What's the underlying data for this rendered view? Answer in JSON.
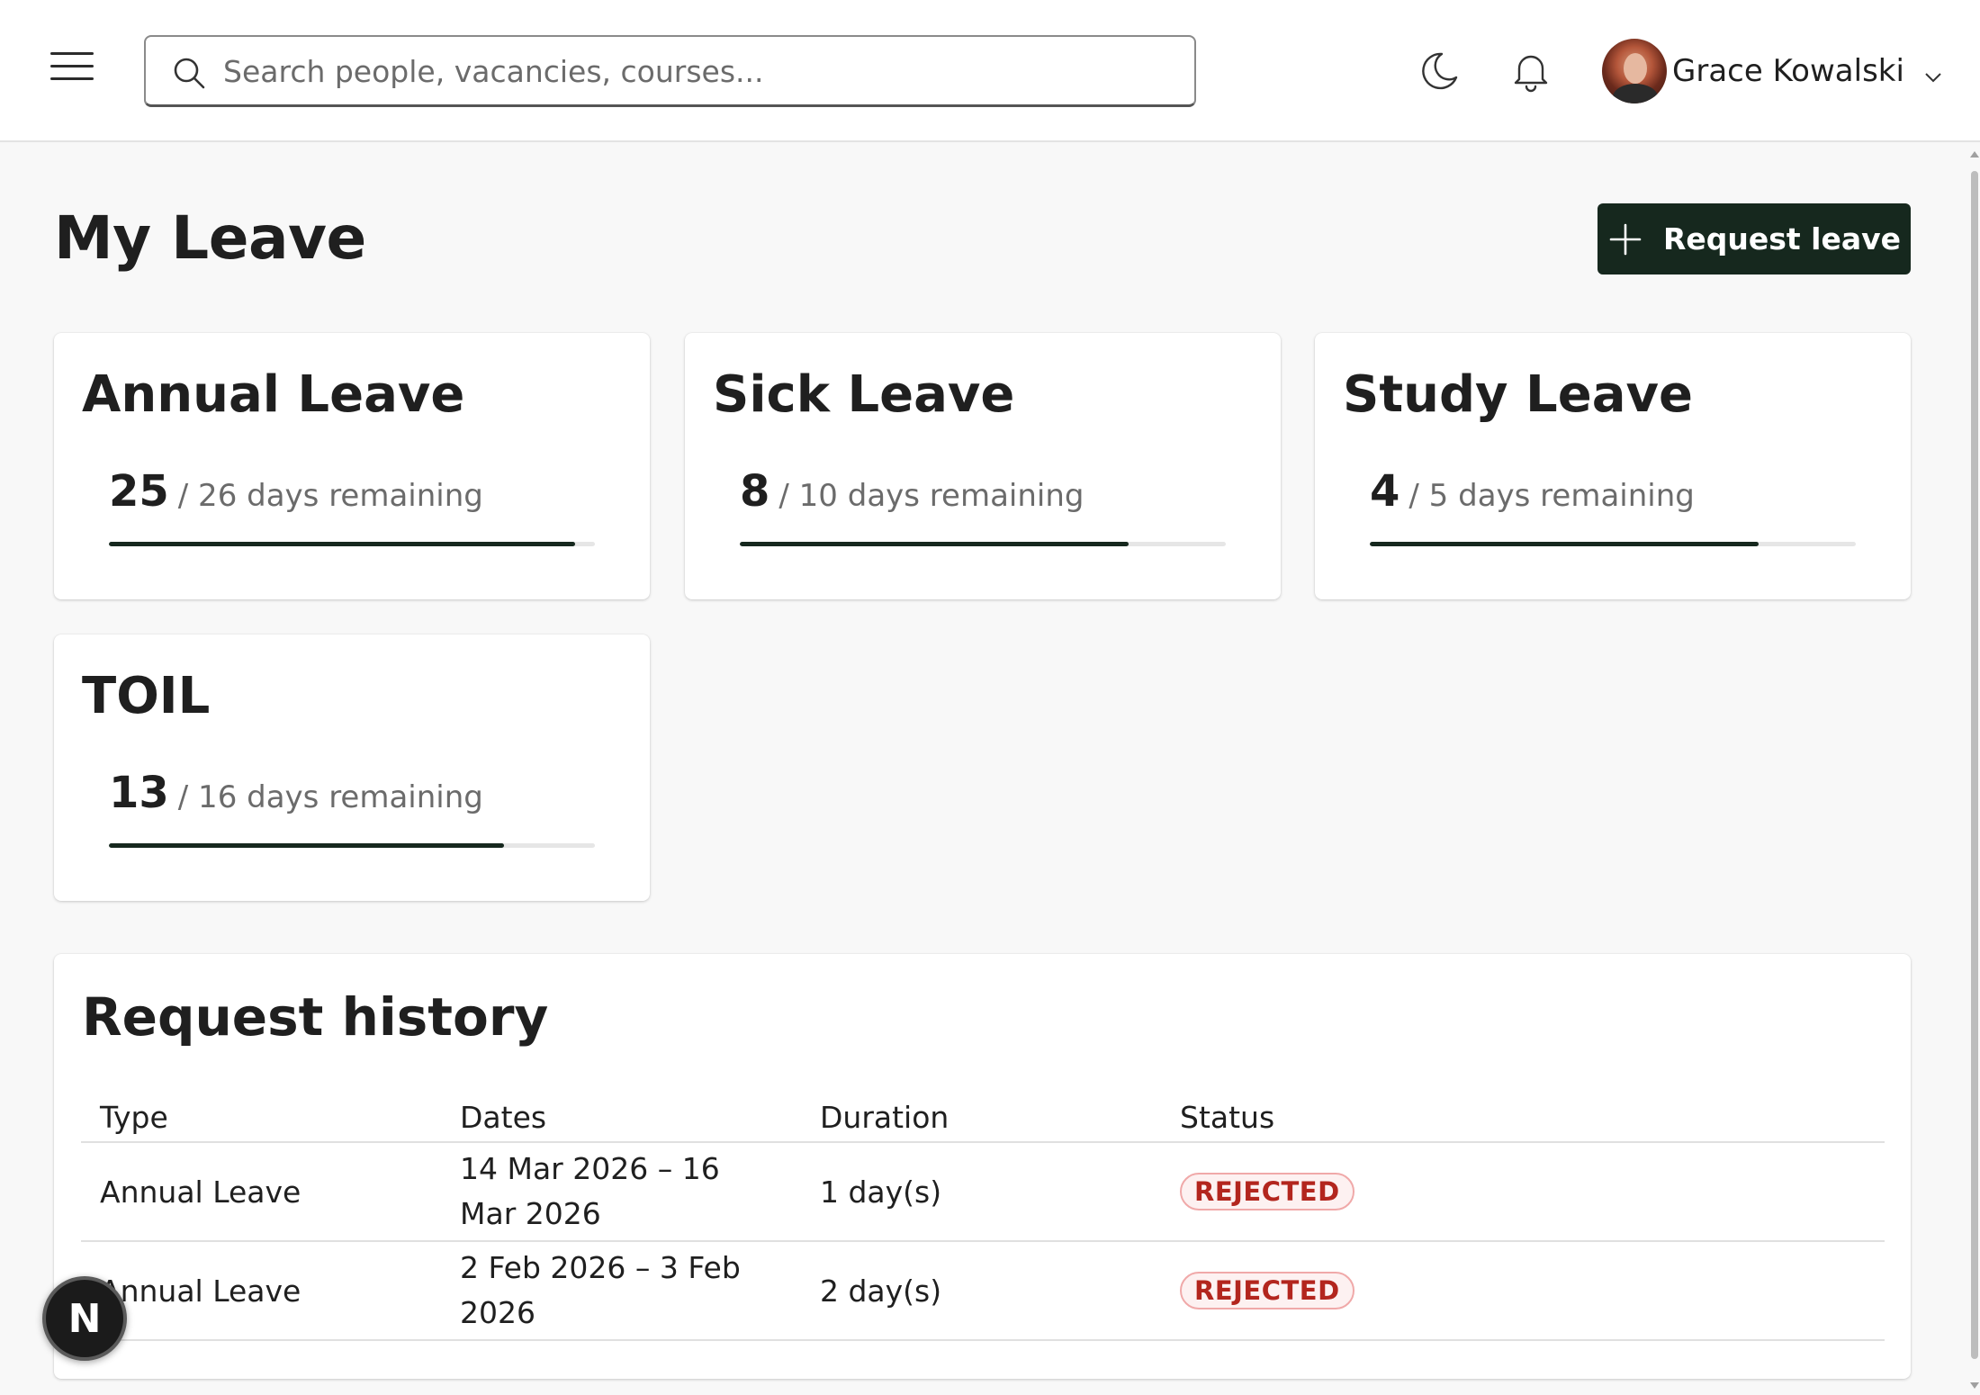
{
  "header": {
    "search_placeholder": "Search people, vacancies, courses...",
    "user_name": "Grace Kowalski"
  },
  "page": {
    "title": "My Leave",
    "request_button_label": "Request leave"
  },
  "balances": [
    {
      "title": "Annual Leave",
      "remaining": "25",
      "rest": "/ 26 days remaining",
      "fraction": 0.96
    },
    {
      "title": "Sick Leave",
      "remaining": "8",
      "rest": "/ 10 days remaining",
      "fraction": 0.8
    },
    {
      "title": "Study Leave",
      "remaining": "4",
      "rest": "/ 5 days remaining",
      "fraction": 0.8
    },
    {
      "title": "TOIL",
      "remaining": "13",
      "rest": "/ 16 days remaining",
      "fraction": 0.8125
    }
  ],
  "history": {
    "title": "Request history",
    "columns": [
      "Type",
      "Dates",
      "Duration",
      "Status"
    ],
    "rows": [
      {
        "type": "Annual Leave",
        "dates": "14 Mar 2026 – 16 Mar 2026",
        "duration": "1 day(s)",
        "status": "REJECTED"
      },
      {
        "type": "Annual Leave",
        "dates": "2 Feb 2026 – 3 Feb 2026",
        "duration": "2 day(s)",
        "status": "REJECTED"
      }
    ]
  },
  "floating_badge": {
    "label": "N"
  },
  "colors": {
    "primary": "#16281e",
    "rejected": "#b3261e",
    "background": "#f8f8f8"
  },
  "icons": [
    "menu-icon",
    "search-icon",
    "moon-icon",
    "bell-icon",
    "chevron-down-icon",
    "plus-icon"
  ]
}
